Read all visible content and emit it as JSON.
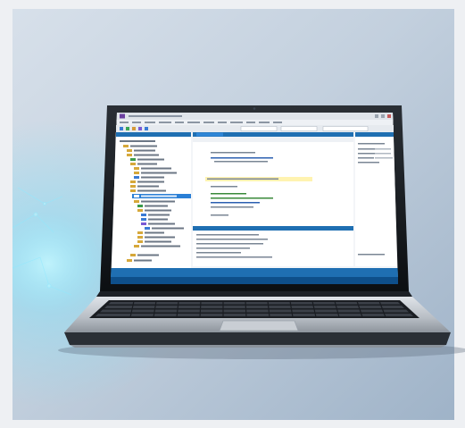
{
  "scene": {
    "colors": {
      "outer_frame": "#eef0f3",
      "background_light": "#dfe6ef",
      "background_mid": "#b7c6d8",
      "background_dark": "#90a6bd",
      "glow": "#6fe3ff",
      "laptop_body": "#111418",
      "keyboard_deck": "#bfc4ca",
      "ide_accent": "#1f6fb2",
      "ide_selection": "#2a7fd6"
    }
  }
}
